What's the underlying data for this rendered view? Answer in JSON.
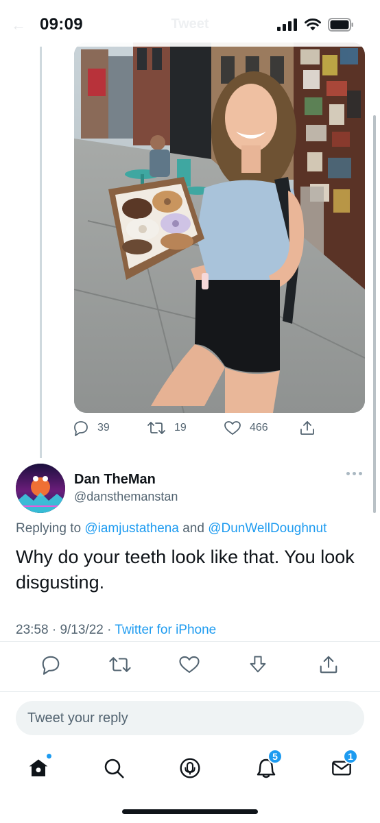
{
  "status_bar": {
    "time": "09:09",
    "title_ghost": "Tweet"
  },
  "quoted_tweet": {
    "photo_description_icon": "photo-image",
    "replies": "39",
    "retweets": "19",
    "likes": "466"
  },
  "reply_tweet": {
    "display_name": "Dan TheMan",
    "handle": "@dansthemanstan",
    "replying_prefix": "Replying to",
    "mention_1": "@iamjustathena",
    "replying_and": "and",
    "mention_2": "@DunWellDoughnut",
    "text": "Why do your teeth look like that. You look disgusting.",
    "time": "23:58",
    "date": "9/13/22",
    "source": "Twitter for iPhone"
  },
  "reply_box": {
    "placeholder": "Tweet your reply"
  },
  "tab_bar": {
    "notifications_badge": "5",
    "messages_badge": "1"
  },
  "colors": {
    "accent": "#1d9bf0",
    "secondary_text": "#536471",
    "primary_text": "#0f1419"
  }
}
